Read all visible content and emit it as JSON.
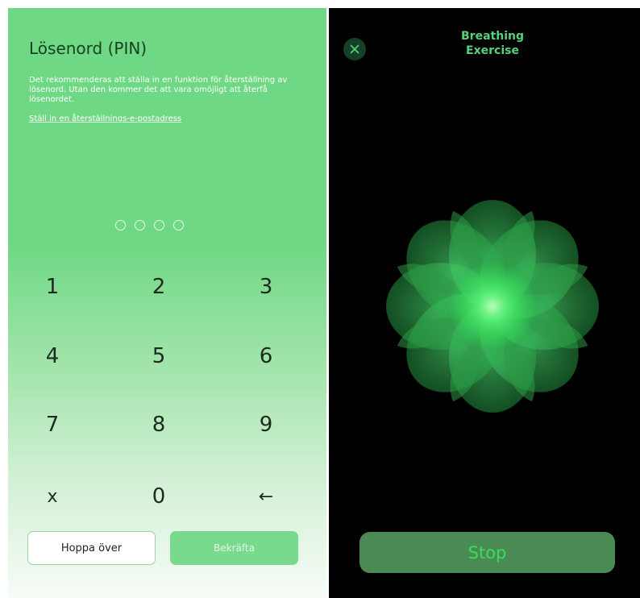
{
  "pin_screen": {
    "title": "Lösenord (PIN)",
    "description": "Det rekommenderas att ställa in en funktion för återställning av lösenord. Utan den kommer det att vara omöjligt att återfå lösenordet.",
    "reset_link": "Ställ in en återställnings-e-postadress",
    "pin_length": 4,
    "pin_entered": 0,
    "keypad": {
      "k1": "1",
      "k2": "2",
      "k3": "3",
      "k4": "4",
      "k5": "5",
      "k6": "6",
      "k7": "7",
      "k8": "8",
      "k9": "9",
      "clear": "x",
      "k0": "0",
      "back": "←"
    },
    "skip_label": "Hoppa över",
    "confirm_label": "Bekräfta",
    "colors": {
      "background": "#6fd884",
      "accent": "#79da8d"
    }
  },
  "breathing_screen": {
    "title_line1": "Breathing",
    "title_line2": "Exercise",
    "close_icon": "close-icon",
    "stop_label": "Stop",
    "colors": {
      "background": "#000000",
      "accent": "#58d17a",
      "button": "#4a8b55"
    }
  }
}
